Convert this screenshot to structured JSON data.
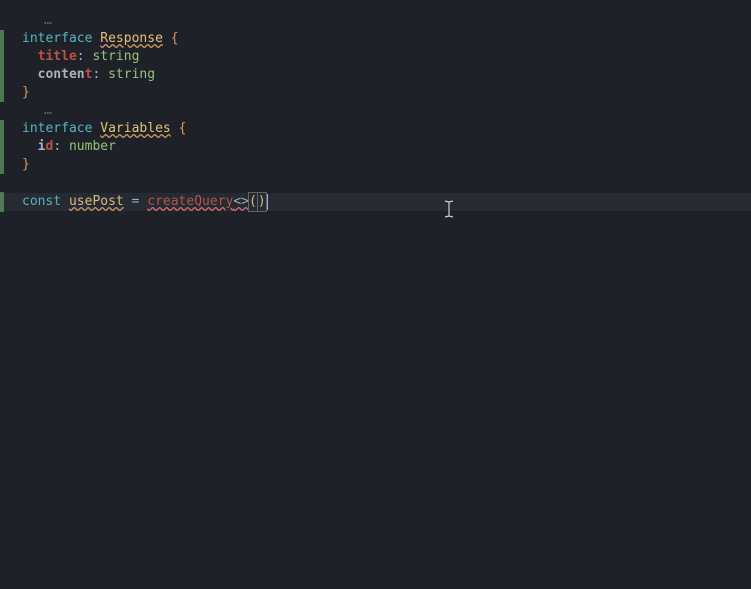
{
  "code": {
    "fold_marker": "…",
    "kw_interface": "interface",
    "iface1_name": "Response",
    "brace_open": "{",
    "brace_close": "}",
    "prop_title_key": "title",
    "colon": ":",
    "space": " ",
    "type_string": "string",
    "prop_content_key_prefix": "conten",
    "prop_content_key_last": "t",
    "iface2_name": "Variables",
    "prop_id_key_prefix": "i",
    "prop_id_key_last": "d",
    "type_number": "number",
    "kw_const": "const",
    "var_name": "usePost",
    "eq": "=",
    "fn_name": "createQuery",
    "angles": "<>",
    "paren_open": "(",
    "paren_close": ")"
  }
}
